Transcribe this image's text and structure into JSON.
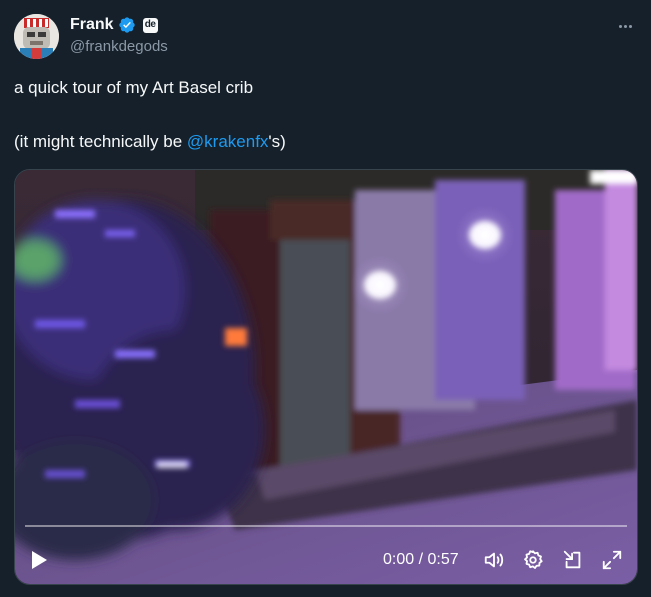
{
  "tweet": {
    "author": {
      "display_name": "Frank",
      "handle": "@frankdegods",
      "affiliation_badge": "de",
      "verified_color": "#1d9bf0"
    },
    "text_line1": "a quick tour of my Art Basel crib",
    "text_line2_prefix": "(it might technically be ",
    "mention": "@krakenfx",
    "text_line2_suffix": "'s)"
  },
  "video": {
    "current_time": "0:00",
    "separator": " / ",
    "duration": "0:57",
    "progress": 0,
    "icons": [
      "play-icon",
      "volume-icon",
      "settings-icon",
      "pip-icon",
      "fullscreen-icon"
    ]
  },
  "colors": {
    "background": "#15202b",
    "text": "#f7f9f9",
    "secondary_text": "#8b98a5",
    "link": "#1d9bf0"
  }
}
